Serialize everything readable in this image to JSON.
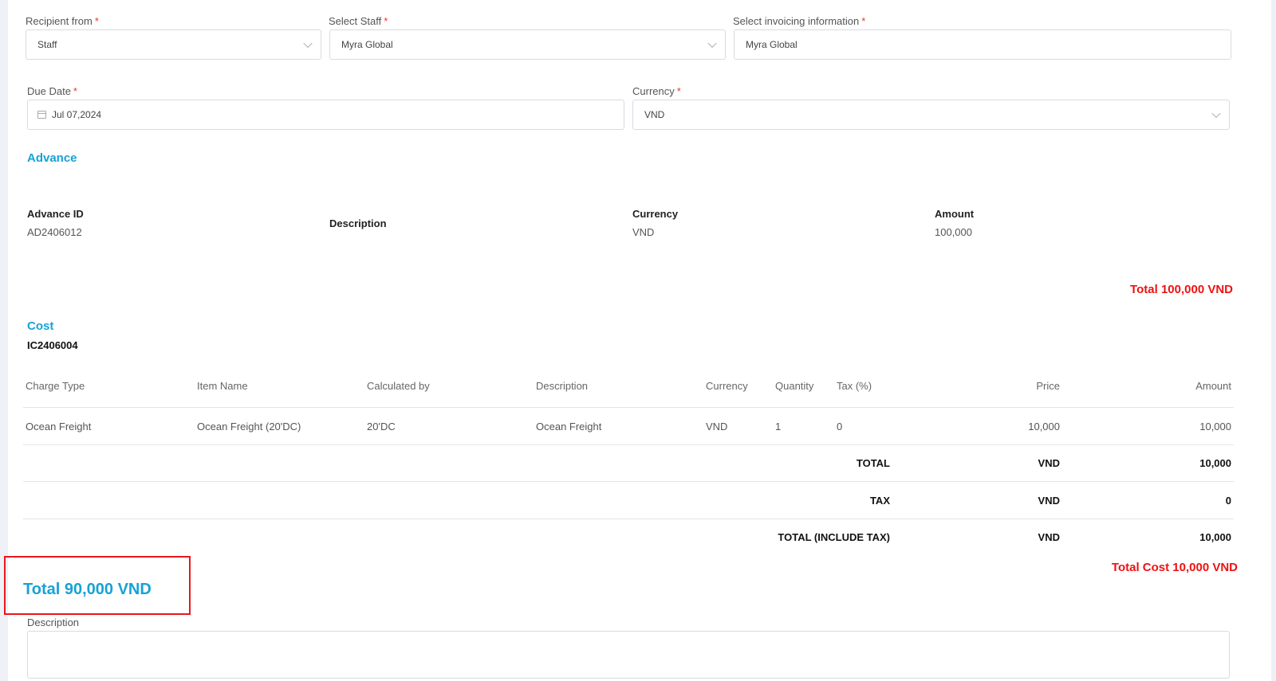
{
  "form": {
    "recipient_from": {
      "label": "Recipient from",
      "value": "Staff"
    },
    "select_staff": {
      "label": "Select Staff",
      "value": "Myra Global"
    },
    "invoicing_info": {
      "label": "Select invoicing information",
      "value": "Myra Global"
    },
    "due_date": {
      "label": "Due Date",
      "value": "Jul 07,2024"
    },
    "currency": {
      "label": "Currency",
      "value": "VND"
    },
    "required_mark": "*"
  },
  "advance": {
    "title": "Advance",
    "columns": {
      "id": "Advance ID",
      "description": "Description",
      "currency": "Currency",
      "amount": "Amount"
    },
    "row": {
      "id": "AD2406012",
      "currency": "VND",
      "amount": "100,000"
    },
    "total_label": "Total",
    "total_value": "100,000 VND"
  },
  "cost": {
    "title": "Cost",
    "code": "IC2406004",
    "headers": [
      "Charge Type",
      "Item Name",
      "Calculated by",
      "Description",
      "Currency",
      "Quantity",
      "Tax (%)",
      "Price",
      "Amount"
    ],
    "rows": [
      [
        "Ocean Freight",
        "Ocean Freight (20'DC)",
        "20'DC",
        "Ocean Freight",
        "VND",
        "1",
        "0",
        "10,000",
        "10,000"
      ]
    ],
    "summary": [
      {
        "label": "TOTAL",
        "currency": "VND",
        "value": "10,000"
      },
      {
        "label": "TAX",
        "currency": "VND",
        "value": "0"
      },
      {
        "label": "TOTAL (INCLUDE TAX)",
        "currency": "VND",
        "value": "10,000"
      }
    ],
    "total_label": "Total Cost",
    "total_value": "10,000 VND"
  },
  "grand_total": "Total 90,000 VND",
  "description_label": "Description",
  "colors": {
    "accent": "#17a2d6",
    "total_red": "#ee1111",
    "highlight_box": "#e8171b"
  }
}
